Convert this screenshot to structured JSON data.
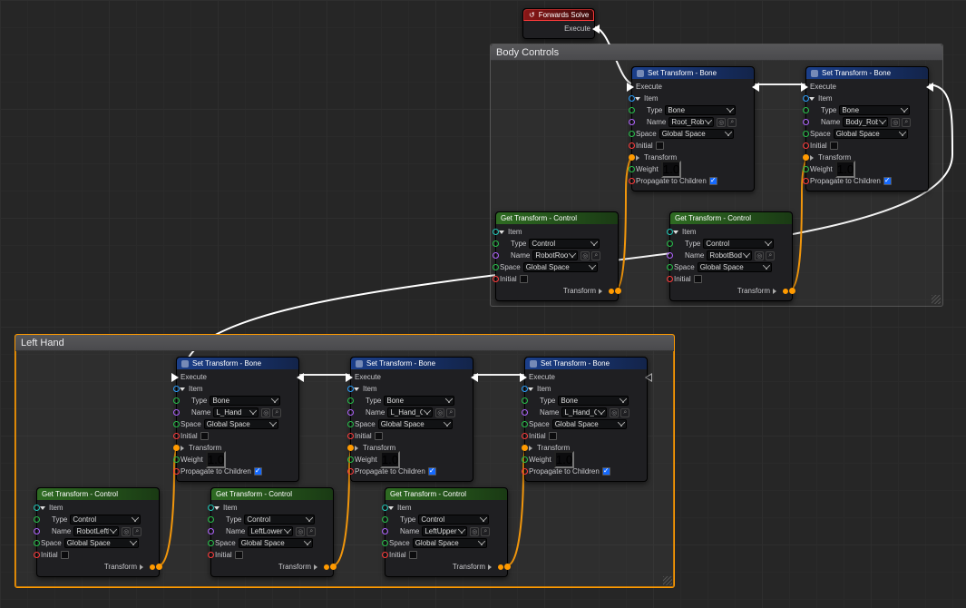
{
  "entry": {
    "title": "Forwards Solve",
    "execute": "Execute"
  },
  "groups": {
    "body": {
      "title": "Body Controls"
    },
    "left": {
      "title": "Left Hand"
    }
  },
  "set_bone": {
    "title": "Set Transform - Bone",
    "execute": "Execute",
    "item": "Item",
    "type_label": "Type",
    "type_value": "Bone",
    "name_label": "Name",
    "space_label": "Space",
    "space_value": "Global Space",
    "initial": "Initial",
    "transform": "Transform",
    "weight_label": "Weight",
    "weight_value": "1.0",
    "propagate": "Propagate to Children"
  },
  "get_ctrl": {
    "title": "Get Transform - Control",
    "item": "Item",
    "type_label": "Type",
    "type_value": "Control",
    "name_label": "Name",
    "space_label": "Space",
    "space_value": "Global Space",
    "initial": "Initial",
    "transform": "Transform"
  },
  "names": {
    "sb_body_root": "Root_Robot",
    "sb_body_body": "Body_Robot",
    "gc_body_root": "RobotRoot",
    "gc_body_body": "RobotBody",
    "sb_lh_hand": "L_Hand",
    "sb_lh_lower": "L_Hand_Claw_Lower",
    "sb_lh_upper": "L_Hand_Claw_Upper",
    "gc_lh_hand": "RobotLeftHand",
    "gc_lh_lower": "LeftLowerClaw",
    "gc_lh_upper": "LeftUpperClaw"
  }
}
